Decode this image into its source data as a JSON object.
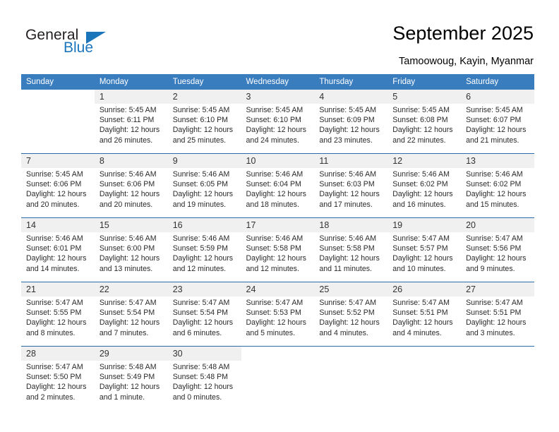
{
  "logo": {
    "word_top": "General",
    "word_bottom": "Blue",
    "triangle_color": "#1b75bb"
  },
  "header": {
    "title": "September 2025",
    "subtitle": "Tamoowoug, Kayin, Myanmar"
  },
  "theme": {
    "header_blue": "#3a7dbf",
    "rule_blue": "#2b6cab",
    "daynum_band": "#f0f0f0"
  },
  "weekday_headers": [
    "Sunday",
    "Monday",
    "Tuesday",
    "Wednesday",
    "Thursday",
    "Friday",
    "Saturday"
  ],
  "weeks": [
    {
      "days": [
        {
          "num": "",
          "lines": []
        },
        {
          "num": "1",
          "lines": [
            "Sunrise: 5:45 AM",
            "Sunset: 6:11 PM",
            "Daylight: 12 hours",
            "and 26 minutes."
          ]
        },
        {
          "num": "2",
          "lines": [
            "Sunrise: 5:45 AM",
            "Sunset: 6:10 PM",
            "Daylight: 12 hours",
            "and 25 minutes."
          ]
        },
        {
          "num": "3",
          "lines": [
            "Sunrise: 5:45 AM",
            "Sunset: 6:10 PM",
            "Daylight: 12 hours",
            "and 24 minutes."
          ]
        },
        {
          "num": "4",
          "lines": [
            "Sunrise: 5:45 AM",
            "Sunset: 6:09 PM",
            "Daylight: 12 hours",
            "and 23 minutes."
          ]
        },
        {
          "num": "5",
          "lines": [
            "Sunrise: 5:45 AM",
            "Sunset: 6:08 PM",
            "Daylight: 12 hours",
            "and 22 minutes."
          ]
        },
        {
          "num": "6",
          "lines": [
            "Sunrise: 5:45 AM",
            "Sunset: 6:07 PM",
            "Daylight: 12 hours",
            "and 21 minutes."
          ]
        }
      ]
    },
    {
      "days": [
        {
          "num": "7",
          "lines": [
            "Sunrise: 5:45 AM",
            "Sunset: 6:06 PM",
            "Daylight: 12 hours",
            "and 20 minutes."
          ]
        },
        {
          "num": "8",
          "lines": [
            "Sunrise: 5:46 AM",
            "Sunset: 6:06 PM",
            "Daylight: 12 hours",
            "and 20 minutes."
          ]
        },
        {
          "num": "9",
          "lines": [
            "Sunrise: 5:46 AM",
            "Sunset: 6:05 PM",
            "Daylight: 12 hours",
            "and 19 minutes."
          ]
        },
        {
          "num": "10",
          "lines": [
            "Sunrise: 5:46 AM",
            "Sunset: 6:04 PM",
            "Daylight: 12 hours",
            "and 18 minutes."
          ]
        },
        {
          "num": "11",
          "lines": [
            "Sunrise: 5:46 AM",
            "Sunset: 6:03 PM",
            "Daylight: 12 hours",
            "and 17 minutes."
          ]
        },
        {
          "num": "12",
          "lines": [
            "Sunrise: 5:46 AM",
            "Sunset: 6:02 PM",
            "Daylight: 12 hours",
            "and 16 minutes."
          ]
        },
        {
          "num": "13",
          "lines": [
            "Sunrise: 5:46 AM",
            "Sunset: 6:02 PM",
            "Daylight: 12 hours",
            "and 15 minutes."
          ]
        }
      ]
    },
    {
      "days": [
        {
          "num": "14",
          "lines": [
            "Sunrise: 5:46 AM",
            "Sunset: 6:01 PM",
            "Daylight: 12 hours",
            "and 14 minutes."
          ]
        },
        {
          "num": "15",
          "lines": [
            "Sunrise: 5:46 AM",
            "Sunset: 6:00 PM",
            "Daylight: 12 hours",
            "and 13 minutes."
          ]
        },
        {
          "num": "16",
          "lines": [
            "Sunrise: 5:46 AM",
            "Sunset: 5:59 PM",
            "Daylight: 12 hours",
            "and 12 minutes."
          ]
        },
        {
          "num": "17",
          "lines": [
            "Sunrise: 5:46 AM",
            "Sunset: 5:58 PM",
            "Daylight: 12 hours",
            "and 12 minutes."
          ]
        },
        {
          "num": "18",
          "lines": [
            "Sunrise: 5:46 AM",
            "Sunset: 5:58 PM",
            "Daylight: 12 hours",
            "and 11 minutes."
          ]
        },
        {
          "num": "19",
          "lines": [
            "Sunrise: 5:47 AM",
            "Sunset: 5:57 PM",
            "Daylight: 12 hours",
            "and 10 minutes."
          ]
        },
        {
          "num": "20",
          "lines": [
            "Sunrise: 5:47 AM",
            "Sunset: 5:56 PM",
            "Daylight: 12 hours",
            "and 9 minutes."
          ]
        }
      ]
    },
    {
      "days": [
        {
          "num": "21",
          "lines": [
            "Sunrise: 5:47 AM",
            "Sunset: 5:55 PM",
            "Daylight: 12 hours",
            "and 8 minutes."
          ]
        },
        {
          "num": "22",
          "lines": [
            "Sunrise: 5:47 AM",
            "Sunset: 5:54 PM",
            "Daylight: 12 hours",
            "and 7 minutes."
          ]
        },
        {
          "num": "23",
          "lines": [
            "Sunrise: 5:47 AM",
            "Sunset: 5:54 PM",
            "Daylight: 12 hours",
            "and 6 minutes."
          ]
        },
        {
          "num": "24",
          "lines": [
            "Sunrise: 5:47 AM",
            "Sunset: 5:53 PM",
            "Daylight: 12 hours",
            "and 5 minutes."
          ]
        },
        {
          "num": "25",
          "lines": [
            "Sunrise: 5:47 AM",
            "Sunset: 5:52 PM",
            "Daylight: 12 hours",
            "and 4 minutes."
          ]
        },
        {
          "num": "26",
          "lines": [
            "Sunrise: 5:47 AM",
            "Sunset: 5:51 PM",
            "Daylight: 12 hours",
            "and 4 minutes."
          ]
        },
        {
          "num": "27",
          "lines": [
            "Sunrise: 5:47 AM",
            "Sunset: 5:51 PM",
            "Daylight: 12 hours",
            "and 3 minutes."
          ]
        }
      ]
    },
    {
      "days": [
        {
          "num": "28",
          "lines": [
            "Sunrise: 5:47 AM",
            "Sunset: 5:50 PM",
            "Daylight: 12 hours",
            "and 2 minutes."
          ]
        },
        {
          "num": "29",
          "lines": [
            "Sunrise: 5:48 AM",
            "Sunset: 5:49 PM",
            "Daylight: 12 hours",
            "and 1 minute."
          ]
        },
        {
          "num": "30",
          "lines": [
            "Sunrise: 5:48 AM",
            "Sunset: 5:48 PM",
            "Daylight: 12 hours",
            "and 0 minutes."
          ]
        },
        {
          "num": "",
          "lines": []
        },
        {
          "num": "",
          "lines": []
        },
        {
          "num": "",
          "lines": []
        },
        {
          "num": "",
          "lines": []
        }
      ]
    }
  ]
}
